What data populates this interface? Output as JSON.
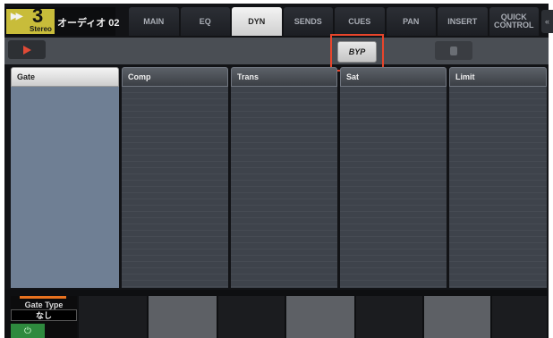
{
  "channel": {
    "number": "3",
    "type": "Stereo",
    "name": "オーディオ 02",
    "color": "#c8bc3a"
  },
  "tabs": [
    {
      "label": "MAIN",
      "active": false
    },
    {
      "label": "EQ",
      "active": false
    },
    {
      "label": "DYN",
      "active": true
    },
    {
      "label": "SENDS",
      "active": false
    },
    {
      "label": "CUES",
      "active": false
    },
    {
      "label": "PAN",
      "active": false
    },
    {
      "label": "INSERT",
      "active": false
    },
    {
      "label": "QUICK\nCONTROL",
      "active": false
    }
  ],
  "toolbar": {
    "byp_label": "BYP",
    "highlight_color": "#e8452b"
  },
  "modules": [
    {
      "label": "Gate",
      "selected": true
    },
    {
      "label": "Comp",
      "selected": false
    },
    {
      "label": "Trans",
      "selected": false
    },
    {
      "label": "Sat",
      "selected": false
    },
    {
      "label": "Limit",
      "selected": false
    }
  ],
  "parameter": {
    "name": "Gate Type",
    "value": "なし",
    "accent_color": "#e8721f",
    "power_color": "#2e8a3e"
  }
}
